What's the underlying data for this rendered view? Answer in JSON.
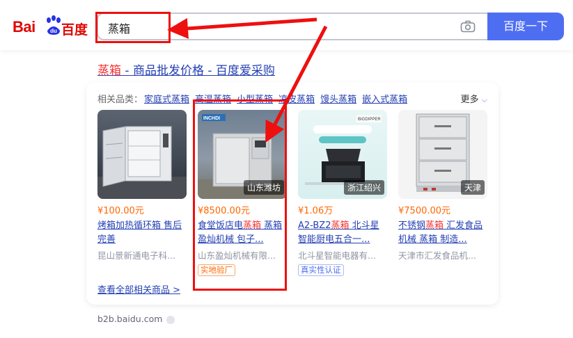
{
  "header": {
    "logo_text": "Bai",
    "logo_du": "du",
    "logo_cn": "百度",
    "search_value": "蒸箱",
    "search_button": "百度一下"
  },
  "result": {
    "title_hl": "蒸箱",
    "title_rest": " - 商品批发价格 - 百度爱采购"
  },
  "card": {
    "related_label": "相关品类：",
    "related": [
      "家庭式蒸箱",
      "高温蒸箱",
      "小型蒸箱",
      "凉皮蒸箱",
      "馒头蒸箱",
      "嵌入式蒸箱"
    ],
    "more": "更多",
    "view_all": "查看全部相关商品 >",
    "products": [
      {
        "price": "¥100.00元",
        "name_a": "烤箱加热循环箱",
        "name_hl": "",
        "name_b": " 售后完善",
        "seller": "昆山景新通电子科...",
        "location": "",
        "tag": ""
      },
      {
        "price": "¥8500.00元",
        "name_a": "食堂饭店电",
        "name_hl": "蒸箱",
        "name_b": " 蒸箱 盈灿机械 包子...",
        "seller": "山东盈灿机械有限...",
        "location": "山东潍坊",
        "tag": "实地验厂"
      },
      {
        "price": "¥1.06万",
        "name_a": "A2-BZ2",
        "name_hl": "蒸箱",
        "name_b": " 北斗星 智能厨电五合一...",
        "seller": "北斗星智能电器有...",
        "location": "浙江绍兴",
        "tag": "真实性认证"
      },
      {
        "price": "¥7500.00元",
        "name_a": "不锈钢",
        "name_hl": "蒸箱",
        "name_b": " 汇发食品机械 蒸箱 制造...",
        "seller": "天津市汇发食品机...",
        "location": "天津",
        "tag": ""
      }
    ]
  },
  "footer": {
    "domain": "b2b.baidu.com"
  },
  "colors": {
    "accent": "#4e6ef2",
    "highlight": "#f73131",
    "price": "#ff6600",
    "annotation": "#ee0f0f"
  },
  "icons": [
    "baidu-paw-icon",
    "camera-icon",
    "chevron-down-icon",
    "shield-icon"
  ]
}
